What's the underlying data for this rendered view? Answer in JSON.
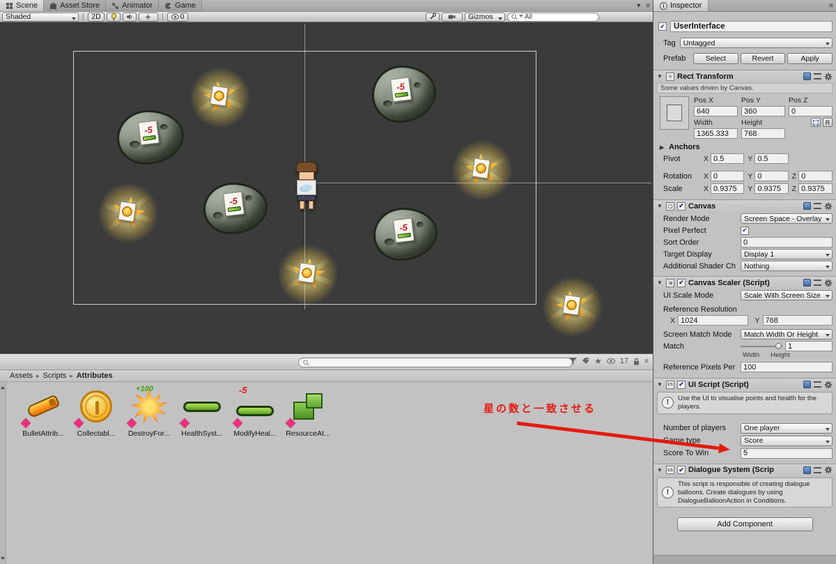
{
  "colors": {
    "annotation_red": "#e51a0f",
    "panel_bg": "#c2c2c2",
    "scene_bg": "#3b3b3b",
    "label_pink": "#ee2f7e"
  },
  "icons": {
    "caret_down": "▾",
    "menu": "≡",
    "foldout_open": "▼",
    "foldout_closed": "▶",
    "crumb_sep": "▸",
    "check": "✔",
    "star": "★",
    "info": "!",
    "inspector_i": "i"
  },
  "window": {
    "left_tabs": [
      {
        "label": "Scene"
      },
      {
        "label": "Asset Store"
      },
      {
        "label": "Animator"
      },
      {
        "label": "Game"
      }
    ],
    "inspector_tab": "Inspector"
  },
  "scene_toolbar": {
    "draw_mode": "Shaded",
    "toggle_2d": "2D",
    "visibility_count": "0",
    "gizmos_label": "Gizmos",
    "search_filter": "All"
  },
  "scene": {
    "rock_damage_label": "-5",
    "annotation_text": "星の数と一致させる"
  },
  "project": {
    "breadcrumb": [
      "Assets",
      "Scripts",
      "Attributes"
    ],
    "result_count": "17",
    "assets": [
      {
        "label": "BulletAttrib..."
      },
      {
        "label": "Collectabl..."
      },
      {
        "label": "DestroyFor...",
        "badge": "+100"
      },
      {
        "label": "HealthSyst..."
      },
      {
        "label": "ModifyHeal...",
        "badge": "-5"
      },
      {
        "label": "ResourceAt..."
      }
    ]
  },
  "inspector": {
    "object_name": "UserInterface",
    "tag_label": "Tag",
    "tag_value": "Untagged",
    "prefab_label": "Prefab",
    "prefab_select": "Select",
    "prefab_revert": "Revert",
    "prefab_apply": "Apply",
    "axis": {
      "x": "X",
      "y": "Y",
      "z": "Z"
    },
    "rect_transform": {
      "title": "Rect Transform",
      "driven_note": "Some values driven by Canvas.",
      "pos_x_label": "Pos X",
      "pos_y_label": "Pos Y",
      "pos_z_label": "Pos Z",
      "pos_x": "640",
      "pos_y": "360",
      "pos_z": "0",
      "width_label": "Width",
      "height_label": "Height",
      "width": "1365.333",
      "height": "768",
      "raw_button": "R",
      "anchors_label": "Anchors",
      "pivot_label": "Pivot",
      "pivot_x": "0.5",
      "pivot_y": "0.5",
      "rotation_label": "Rotation",
      "rotation_x": "0",
      "rotation_y": "0",
      "rotation_z": "0",
      "scale_label": "Scale",
      "scale_x": "0.9375",
      "scale_y": "0.9375",
      "scale_z": "0.9375"
    },
    "canvas": {
      "title": "Canvas",
      "render_mode_label": "Render Mode",
      "render_mode": "Screen Space - Overlay",
      "pixel_perfect_label": "Pixel Perfect",
      "sort_order_label": "Sort Order",
      "sort_order": "0",
      "target_display_label": "Target Display",
      "target_display": "Display 1",
      "additional_shader_label": "Additional Shader Ch",
      "additional_shader": "Nothing"
    },
    "canvas_scaler": {
      "title": "Canvas Scaler (Script)",
      "ui_scale_mode_label": "UI Scale Mode",
      "ui_scale_mode": "Scale With Screen Size",
      "reference_resolution_label": "Reference Resolution",
      "ref_x": "1024",
      "ref_y": "768",
      "screen_match_label": "Screen Match Mode",
      "screen_match": "Match Width Or Height",
      "match_label": "Match",
      "match_value": "1",
      "width_small": "Width",
      "height_small": "Height",
      "ref_ppu_label": "Reference Pixels Per",
      "ref_ppu": "100"
    },
    "ui_script": {
      "title": "UI Script (Script)",
      "help_text": "Use the UI to visualise points and health for the players.",
      "players_label": "Number of players",
      "players_value": "One player",
      "game_type_label": "Game type",
      "game_type_value": "Score",
      "score_label": "Score To Win",
      "score_value": "5"
    },
    "dialogue": {
      "title": "Dialogue System (Scrip",
      "help_text": "This script is responsible of creating dialogue balloons. Create dialogues by using DialogueBalloonAction in Conditions."
    },
    "add_component": "Add Component"
  }
}
